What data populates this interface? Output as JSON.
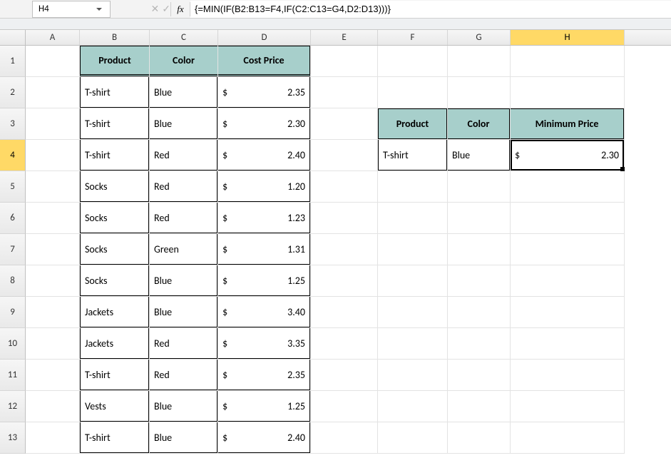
{
  "name_box": "H4",
  "fx_label": "fx",
  "formula": "{=MIN(IF(B2:B13=F4,IF(C2:C13=G4,D2:D13)))}",
  "columns": [
    "A",
    "B",
    "C",
    "D",
    "E",
    "F",
    "G",
    "H"
  ],
  "active_col": "H",
  "active_row": 4,
  "rows": [
    1,
    2,
    3,
    4,
    5,
    6,
    7,
    8,
    9,
    10,
    11,
    12,
    13
  ],
  "main_table": {
    "headers": {
      "B": "Product",
      "C": "Color",
      "D": "Cost Price"
    },
    "rows": [
      {
        "product": "T-shirt",
        "color": "Blue",
        "sym": "$",
        "price": "2.35"
      },
      {
        "product": "T-shirt",
        "color": "Blue",
        "sym": "$",
        "price": "2.30"
      },
      {
        "product": "T-shirt",
        "color": "Red",
        "sym": "$",
        "price": "2.40"
      },
      {
        "product": "Socks",
        "color": "Red",
        "sym": "$",
        "price": "1.20"
      },
      {
        "product": "Socks",
        "color": "Red",
        "sym": "$",
        "price": "1.23"
      },
      {
        "product": "Socks",
        "color": "Green",
        "sym": "$",
        "price": "1.31"
      },
      {
        "product": "Socks",
        "color": "Blue",
        "sym": "$",
        "price": "1.25"
      },
      {
        "product": "Jackets",
        "color": "Blue",
        "sym": "$",
        "price": "3.40"
      },
      {
        "product": "Jackets",
        "color": "Red",
        "sym": "$",
        "price": "3.35"
      },
      {
        "product": "T-shirt",
        "color": "Red",
        "sym": "$",
        "price": "2.35"
      },
      {
        "product": "Vests",
        "color": "Blue",
        "sym": "$",
        "price": "1.25"
      },
      {
        "product": "T-shirt",
        "color": "Blue",
        "sym": "$",
        "price": "2.40"
      }
    ]
  },
  "lookup_table": {
    "headers": {
      "F": "Product",
      "G": "Color",
      "H": "Minimum Price"
    },
    "row": {
      "product": "T-shirt",
      "color": "Blue",
      "sym": "$",
      "price": "2.30"
    }
  }
}
